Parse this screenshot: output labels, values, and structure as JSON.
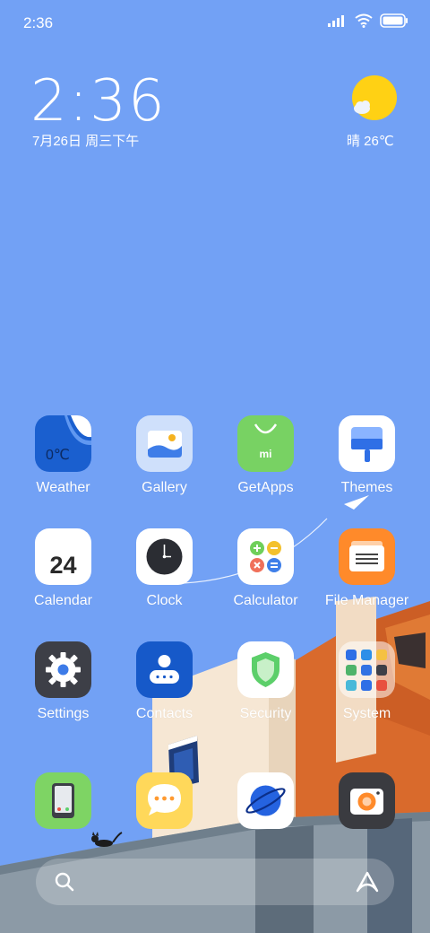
{
  "status": {
    "time": "2:36",
    "icons": [
      "signal-icon",
      "wifi-icon",
      "battery-icon"
    ]
  },
  "widget": {
    "time": "2:36",
    "date": "7月26日 周三下午",
    "weather": "晴 26℃",
    "weather_icon": "sun-cloud-icon"
  },
  "apps": [
    {
      "label": "Weather",
      "icon": "weather-icon",
      "tile_text": "0℃"
    },
    {
      "label": "Gallery",
      "icon": "gallery-icon"
    },
    {
      "label": "GetApps",
      "icon": "getapps-icon",
      "tile_text": "mi"
    },
    {
      "label": "Themes",
      "icon": "themes-icon"
    },
    {
      "label": "Calendar",
      "icon": "calendar-icon",
      "tile_text": "24"
    },
    {
      "label": "Clock",
      "icon": "clock-icon"
    },
    {
      "label": "Calculator",
      "icon": "calculator-icon"
    },
    {
      "label": "File Manager",
      "icon": "file-manager-icon"
    },
    {
      "label": "Settings",
      "icon": "settings-icon"
    },
    {
      "label": "Contacts",
      "icon": "contacts-icon"
    },
    {
      "label": "Security",
      "icon": "security-icon"
    },
    {
      "label": "System",
      "icon": "system-folder-icon"
    }
  ],
  "dock": [
    {
      "icon": "phone-icon"
    },
    {
      "icon": "messages-icon"
    },
    {
      "icon": "browser-icon"
    },
    {
      "icon": "camera-icon"
    }
  ],
  "search": {
    "icon": "search-icon",
    "assistant_icon": "assistant-icon"
  },
  "colors": {
    "wallpaper_sky": "#72a1f5",
    "building_orange": "#d96a2c",
    "building_cream": "#f6e7d4"
  }
}
